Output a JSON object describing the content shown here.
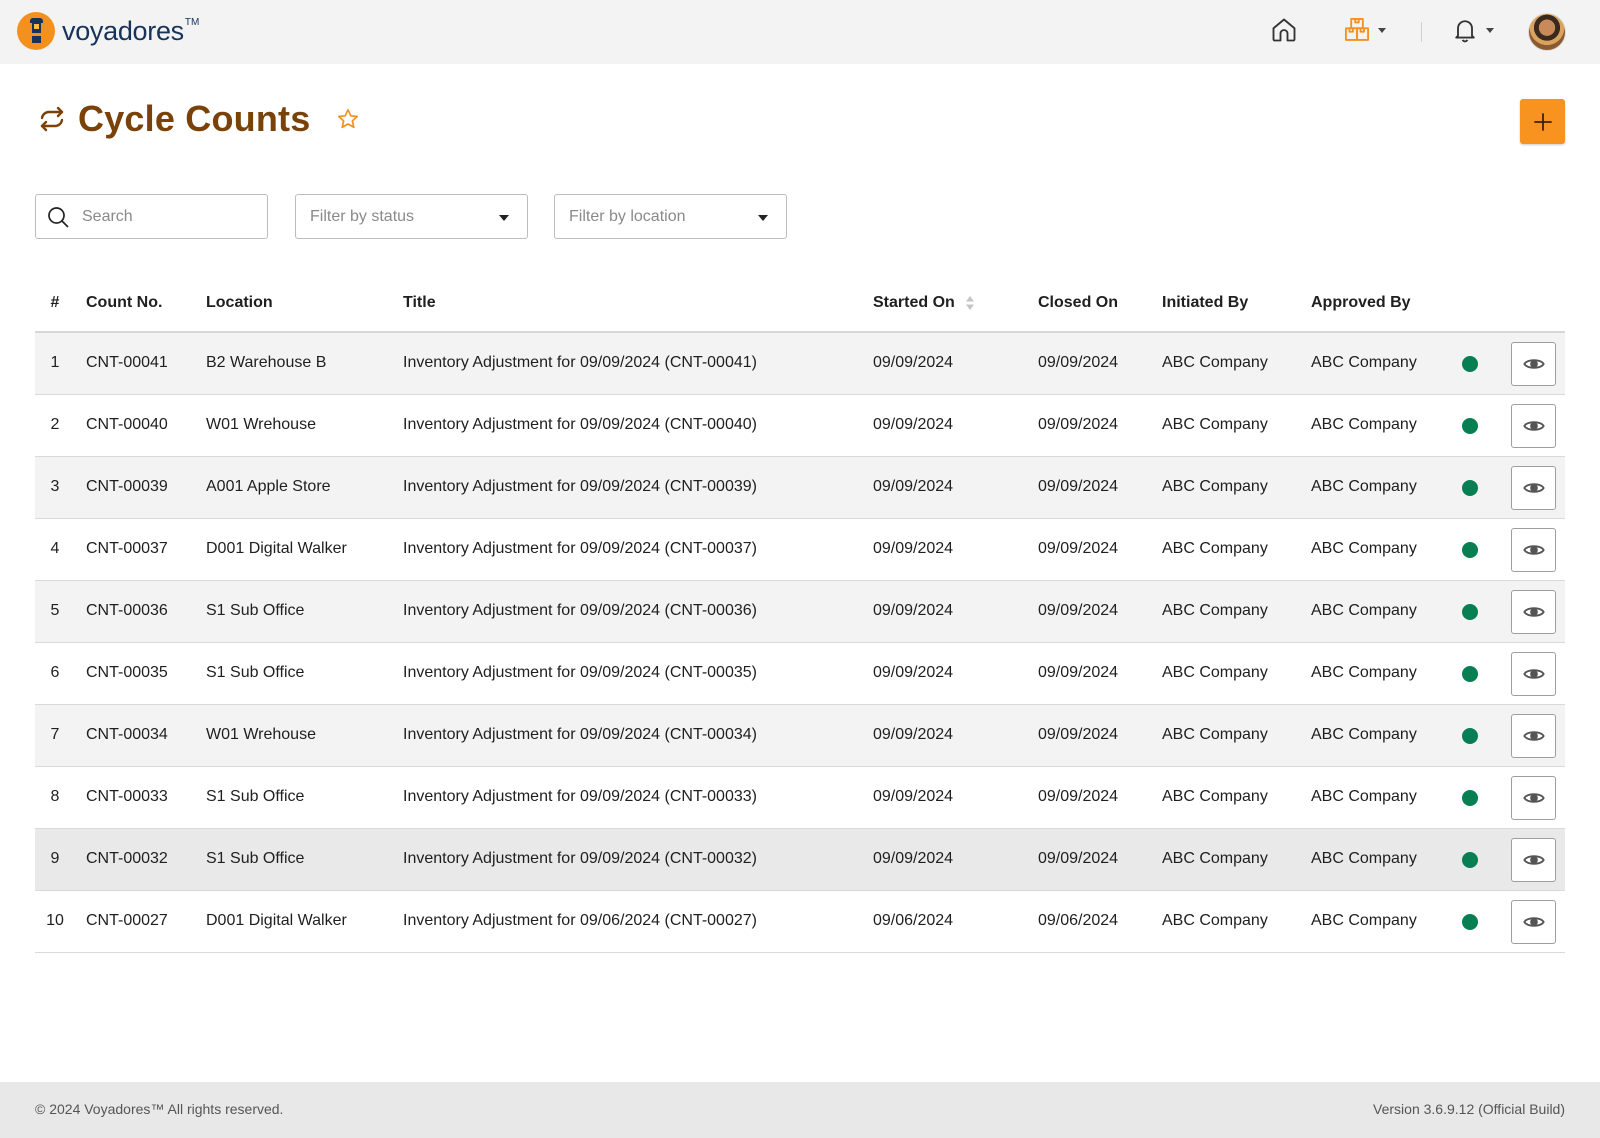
{
  "brand": {
    "name": "voyadores",
    "trademark": "TM"
  },
  "header": {
    "icons": [
      "home-icon",
      "warehouse-icon",
      "bell-icon"
    ]
  },
  "page": {
    "title": "Cycle Counts",
    "title_icon": "cycle-icon",
    "add_label": "+"
  },
  "filters": {
    "search_placeholder": "Search",
    "status_placeholder": "Filter by status",
    "location_placeholder": "Filter by location"
  },
  "table": {
    "columns": [
      "#",
      "Count No.",
      "Location",
      "Title",
      "Started On",
      "Closed On",
      "Initiated By",
      "Approved By"
    ],
    "rows": [
      {
        "num": "1",
        "count": "CNT-00041",
        "location": "B2 Warehouse B",
        "title": "Inventory Adjustment for 09/09/2024 (CNT-00041)",
        "started": "09/09/2024",
        "closed": "09/09/2024",
        "initiated": "ABC Company",
        "approved": "ABC Company"
      },
      {
        "num": "2",
        "count": "CNT-00040",
        "location": "W01 Wrehouse",
        "title": "Inventory Adjustment for 09/09/2024 (CNT-00040)",
        "started": "09/09/2024",
        "closed": "09/09/2024",
        "initiated": "ABC Company",
        "approved": "ABC Company"
      },
      {
        "num": "3",
        "count": "CNT-00039",
        "location": "A001 Apple Store",
        "title": "Inventory Adjustment for 09/09/2024 (CNT-00039)",
        "started": "09/09/2024",
        "closed": "09/09/2024",
        "initiated": "ABC Company",
        "approved": "ABC Company"
      },
      {
        "num": "4",
        "count": "CNT-00037",
        "location": "D001 Digital Walker",
        "title": "Inventory Adjustment for 09/09/2024 (CNT-00037)",
        "started": "09/09/2024",
        "closed": "09/09/2024",
        "initiated": "ABC Company",
        "approved": "ABC Company"
      },
      {
        "num": "5",
        "count": "CNT-00036",
        "location": "S1 Sub Office",
        "title": "Inventory Adjustment for 09/09/2024 (CNT-00036)",
        "started": "09/09/2024",
        "closed": "09/09/2024",
        "initiated": "ABC Company",
        "approved": "ABC Company"
      },
      {
        "num": "6",
        "count": "CNT-00035",
        "location": "S1 Sub Office",
        "title": "Inventory Adjustment for 09/09/2024 (CNT-00035)",
        "started": "09/09/2024",
        "closed": "09/09/2024",
        "initiated": "ABC Company",
        "approved": "ABC Company"
      },
      {
        "num": "7",
        "count": "CNT-00034",
        "location": "W01 Wrehouse",
        "title": "Inventory Adjustment for 09/09/2024 (CNT-00034)",
        "started": "09/09/2024",
        "closed": "09/09/2024",
        "initiated": "ABC Company",
        "approved": "ABC Company"
      },
      {
        "num": "8",
        "count": "CNT-00033",
        "location": "S1 Sub Office",
        "title": "Inventory Adjustment for 09/09/2024 (CNT-00033)",
        "started": "09/09/2024",
        "closed": "09/09/2024",
        "initiated": "ABC Company",
        "approved": "ABC Company"
      },
      {
        "num": "9",
        "count": "CNT-00032",
        "location": "S1 Sub Office",
        "title": "Inventory Adjustment for 09/09/2024 (CNT-00032)",
        "started": "09/09/2024",
        "closed": "09/09/2024",
        "initiated": "ABC Company",
        "approved": "ABC Company"
      },
      {
        "num": "10",
        "count": "CNT-00027",
        "location": "D001 Digital Walker",
        "title": "Inventory Adjustment for 09/06/2024 (CNT-00027)",
        "started": "09/06/2024",
        "closed": "09/06/2024",
        "initiated": "ABC Company",
        "approved": "ABC Company"
      }
    ]
  },
  "colors": {
    "accent": "#f7931e",
    "title": "#7a4208",
    "status_active": "#077f53"
  },
  "footer": {
    "copyright": "© 2024 Voyadores™ All rights reserved.",
    "version": "Version 3.6.9.12 (Official Build)"
  }
}
